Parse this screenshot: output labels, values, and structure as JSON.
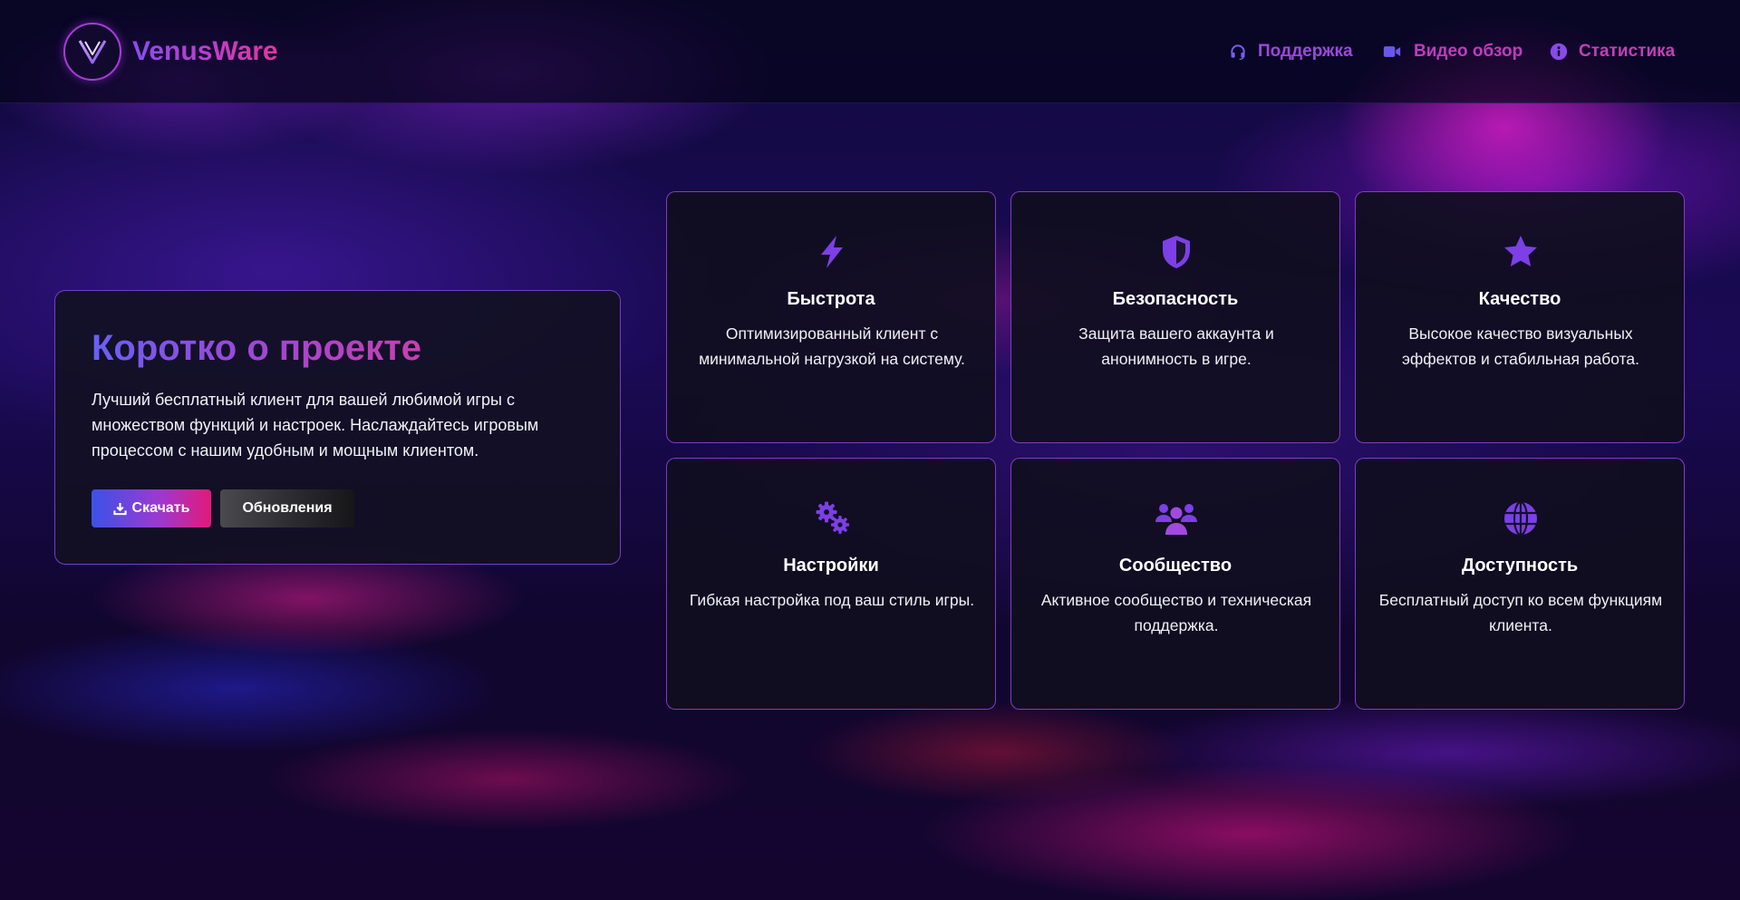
{
  "brand": {
    "name": "VenusWare"
  },
  "nav": [
    {
      "label": "Поддержка",
      "icon": "headset-icon"
    },
    {
      "label": "Видео обзор",
      "icon": "video-camera-icon"
    },
    {
      "label": "Статистика",
      "icon": "info-icon"
    }
  ],
  "about": {
    "title": "Коротко о проекте",
    "description": "Лучший бесплатный клиент для вашей любимой игры с множеством функций и настроек. Наслаждайтесь игровым процессом с нашим удобным и мощным клиентом.",
    "download_label": "Скачать",
    "updates_label": "Обновления"
  },
  "features": [
    {
      "title": "Быстрота",
      "description": "Оптимизированный клиент с минимальной нагрузкой на систему.",
      "icon": "lightning-icon"
    },
    {
      "title": "Безопасность",
      "description": "Защита вашего аккаунта и анонимность в игре.",
      "icon": "shield-icon"
    },
    {
      "title": "Качество",
      "description": "Высокое качество визуальных эффектов и стабильная работа.",
      "icon": "star-icon"
    },
    {
      "title": "Настройки",
      "description": "Гибкая настройка под ваш стиль игры.",
      "icon": "gears-icon"
    },
    {
      "title": "Сообщество",
      "description": "Активное сообщество и техническая поддержка.",
      "icon": "users-icon"
    },
    {
      "title": "Доступность",
      "description": "Бесплатный доступ ко всем функциям клиента.",
      "icon": "globe-icon"
    }
  ],
  "colors": {
    "accent_purple": "#7b3fe4",
    "accent_pink": "#e21a78",
    "accent_blue": "#3a52e8"
  }
}
